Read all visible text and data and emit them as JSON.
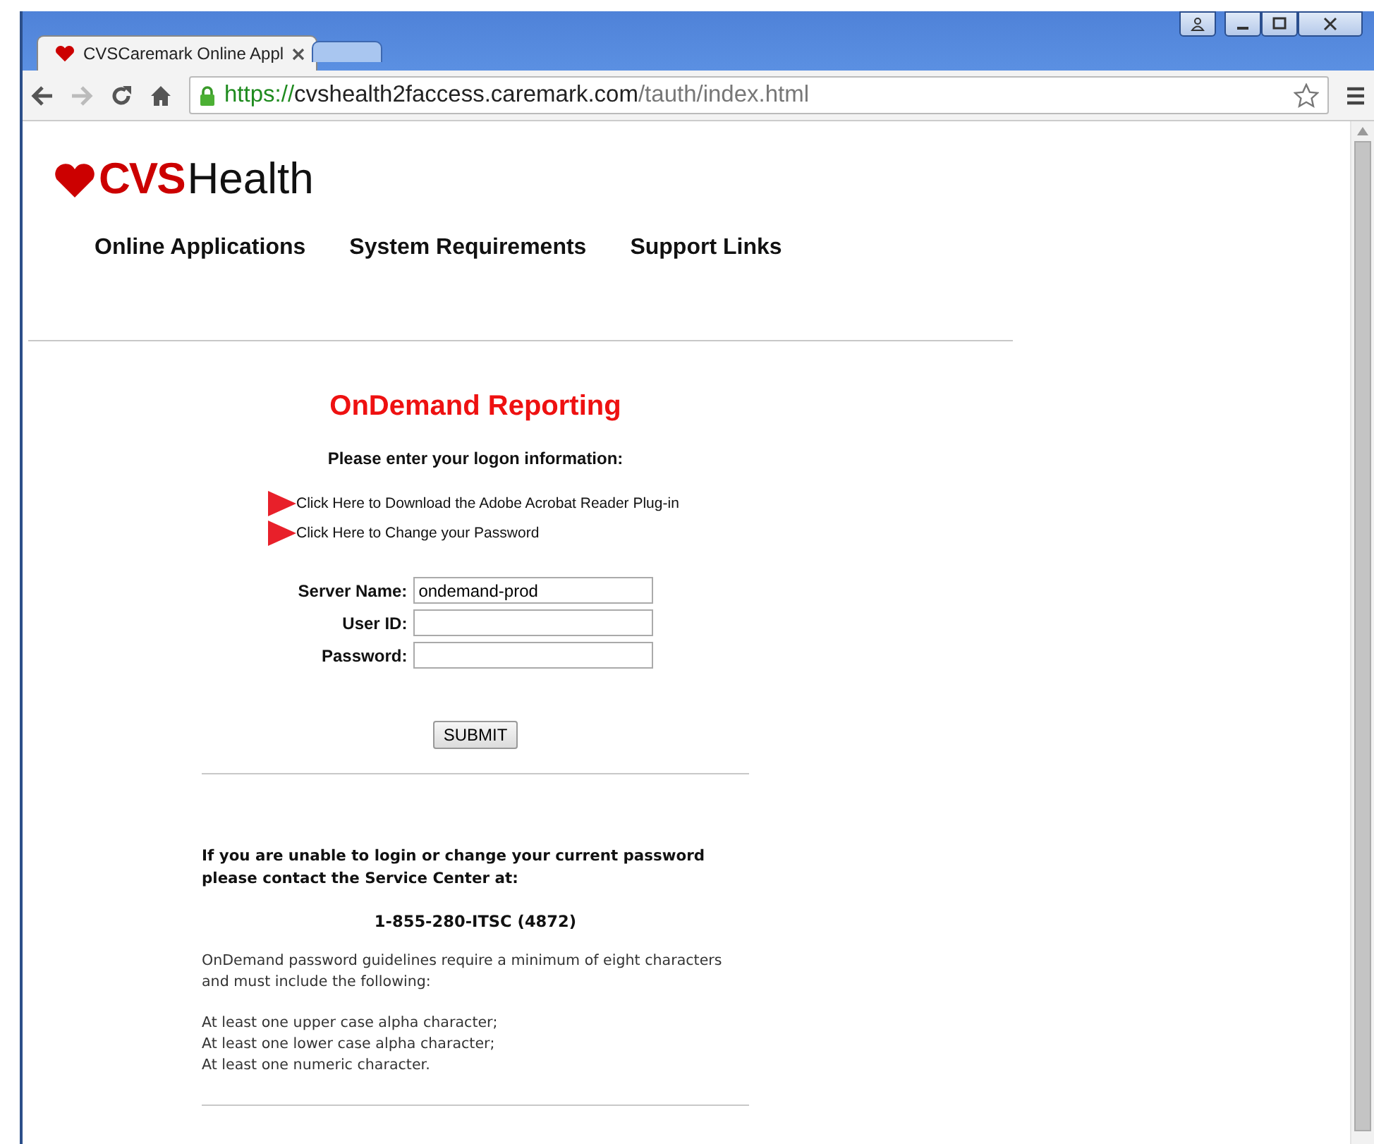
{
  "browser": {
    "tabs": [
      {
        "title": "CVSCaremark Online Appl",
        "selected": true
      },
      {
        "selected": false
      }
    ],
    "url": {
      "scheme": "https://",
      "host": "cvshealth2faccess.caremark.com",
      "path": "/tauth/index.html"
    }
  },
  "logo": {
    "brand": "CVS",
    "suffix": "Health"
  },
  "nav": [
    "Online Applications",
    "System Requirements",
    "Support Links"
  ],
  "title": "OnDemand Reporting",
  "subtitle": "Please enter your logon information:",
  "links": [
    "Click Here to Download the Adobe Acrobat Reader Plug-in",
    "Click Here to Change your Password"
  ],
  "fields": [
    {
      "label": "Server Name:",
      "value": "ondemand-prod"
    },
    {
      "label": "User ID:"
    },
    {
      "label": "Password:"
    }
  ],
  "submit": "SUBMIT",
  "contact": "If you are unable to login or change your current password please contact the Service Center at:",
  "phone": "1-855-280-ITSC (4872)",
  "guidelines": "OnDemand password guidelines require a minimum of eight characters and must include the following:",
  "rules": [
    "At least one upper case alpha character;",
    "At least one lower case alpha character;",
    "At least one numeric character."
  ]
}
